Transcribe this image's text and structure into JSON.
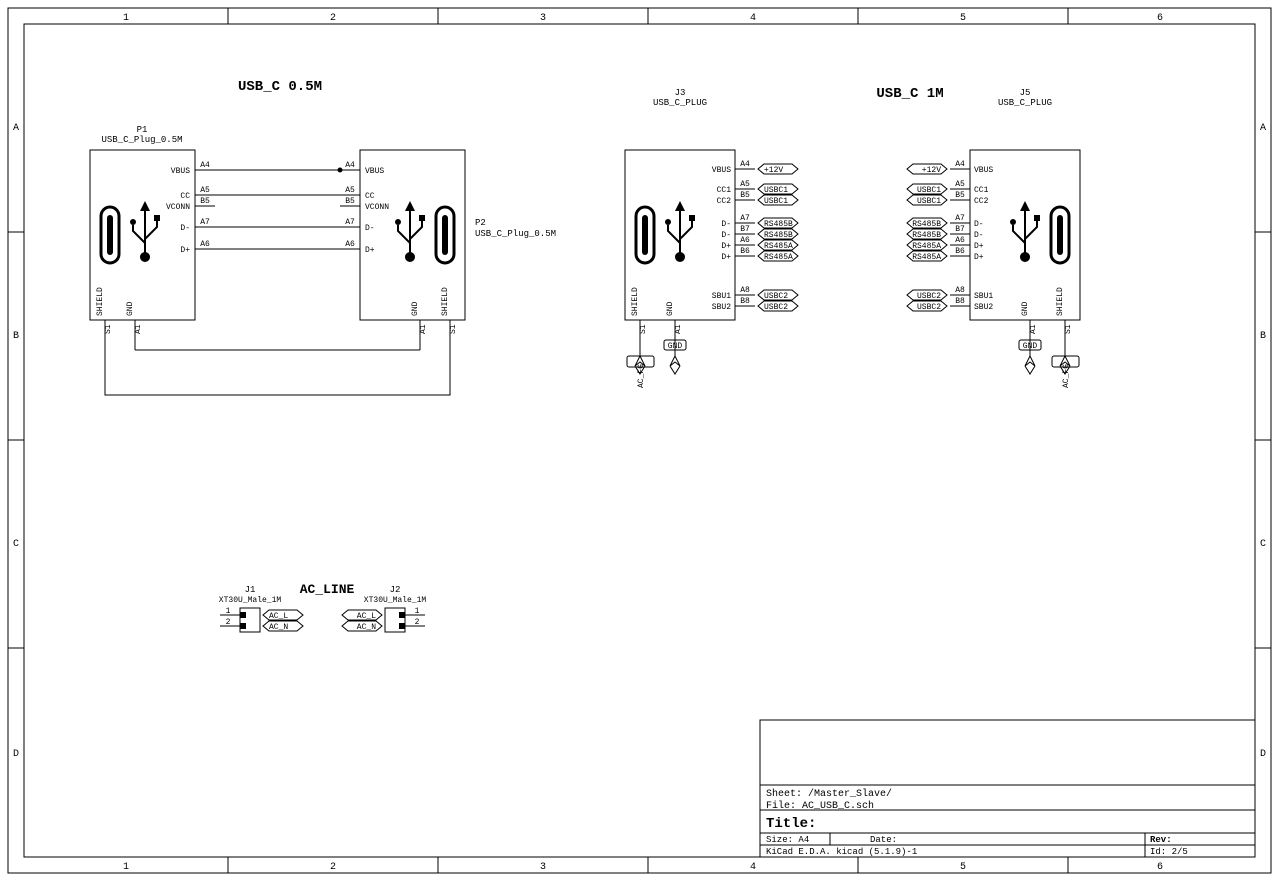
{
  "titles": {
    "section1": "USB_C 0.5M",
    "section2": "USB_C 1M",
    "section3": "AC_LINE"
  },
  "components": {
    "P1": {
      "ref": "P1",
      "name": "USB_C_Plug_0.5M",
      "pins": {
        "vbus": "VBUS",
        "cc": "CC",
        "vconn": "VCONN",
        "dminus": "D-",
        "dplus": "D+",
        "a4": "A4",
        "a5": "A5",
        "b5": "B5",
        "a7": "A7",
        "a6": "A6",
        "shield": "SHIELD",
        "gnd": "GND",
        "s1": "S1",
        "a1": "A1"
      }
    },
    "P2": {
      "ref": "P2",
      "name": "USB_C_Plug_0.5M",
      "pins": {
        "vbus": "VBUS",
        "cc": "CC",
        "vconn": "VCONN",
        "dminus": "D-",
        "dplus": "D+",
        "a4": "A4",
        "a5": "A5",
        "b5": "B5",
        "a7": "A7",
        "a6": "A6",
        "shield": "SHIELD",
        "gnd": "GND",
        "s1": "S1",
        "a1": "A1"
      }
    },
    "J3": {
      "ref": "J3",
      "name": "USB_C_PLUG",
      "pins": {
        "vbus": "VBUS",
        "cc1": "CC1",
        "cc2": "CC2",
        "dminus1": "D-",
        "dminus2": "D-",
        "dplus1": "D+",
        "dplus2": "D+",
        "sbu1": "SBU1",
        "sbu2": "SBU2",
        "a4": "A4",
        "a5": "A5",
        "b5": "B5",
        "a7": "A7",
        "b7": "B7",
        "a6": "A6",
        "b6": "B6",
        "a8": "A8",
        "b8": "B8",
        "shield": "SHIELD",
        "gnd": "GND",
        "s1": "S1",
        "a1": "A1"
      }
    },
    "J5": {
      "ref": "J5",
      "name": "USB_C_PLUG",
      "pins": {
        "vbus": "VBUS",
        "cc1": "CC1",
        "cc2": "CC2",
        "dminus1": "D-",
        "dminus2": "D-",
        "dplus1": "D+",
        "dplus2": "D+",
        "sbu1": "SBU1",
        "sbu2": "SBU2",
        "a4": "A4",
        "a5": "A5",
        "b5": "B5",
        "a7": "A7",
        "b7": "B7",
        "a6": "A6",
        "b6": "B6",
        "a8": "A8",
        "b8": "B8",
        "shield": "SHIELD",
        "gnd": "GND",
        "s1": "S1",
        "a1": "A1"
      }
    },
    "J1": {
      "ref": "J1",
      "name": "XT30U_Male_1M",
      "p1": "1",
      "p2": "2"
    },
    "J2": {
      "ref": "J2",
      "name": "XT30U_Male_1M",
      "p1": "1",
      "p2": "2"
    }
  },
  "nets": {
    "plus12v": "+12V",
    "usbc1": "USBC1",
    "usbc2": "USBC2",
    "rs485a": "RS485A",
    "rs485b": "RS485B",
    "gnd": "GND",
    "acfg": "AC_FG",
    "acl": "AC_L",
    "acn": "AC_N"
  },
  "title_block": {
    "sheet_label": "Sheet:",
    "sheet_value": "/Master_Slave/",
    "file_label": "File:",
    "file_value": "AC_USB_C.sch",
    "title_label": "Title:",
    "size_label": "Size:",
    "size_value": "A4",
    "date_label": "Date:",
    "rev_label": "Rev:",
    "tool": "KiCad E.D.A.  kicad (5.1.9)-1",
    "id_label": "Id:",
    "id_value": "2/5"
  },
  "ruler": {
    "n1": "1",
    "n2": "2",
    "n3": "3",
    "n4": "4",
    "n5": "5",
    "n6": "6",
    "a": "A",
    "b": "B",
    "c": "C",
    "d": "D"
  }
}
